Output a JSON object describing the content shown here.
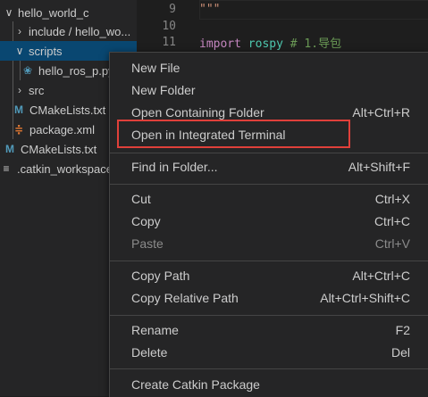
{
  "explorer": {
    "items": [
      {
        "label": "hello_world_c",
        "chevron": "down",
        "icon": ""
      },
      {
        "label": "include / hello_wo...",
        "chevron": "right",
        "icon": ""
      },
      {
        "label": "scripts",
        "chevron": "down",
        "icon": ""
      },
      {
        "label": "hello_ros_p.py",
        "chevron": "",
        "icon": "python-file-icon"
      },
      {
        "label": "src",
        "chevron": "right",
        "icon": ""
      },
      {
        "label": "CMakeLists.txt",
        "chevron": "",
        "icon": "cmake-file-icon"
      },
      {
        "label": "package.xml",
        "chevron": "",
        "icon": "rss-xml-file-icon"
      },
      {
        "label": "CMakeLists.txt",
        "chevron": "",
        "icon": "cmake-file-icon"
      },
      {
        "label": ".catkin_workspace",
        "chevron": "",
        "icon": "config-file-icon"
      }
    ]
  },
  "editor": {
    "lines": [
      {
        "num": "9",
        "text": "\"\"\""
      },
      {
        "num": "10",
        "text": ""
      },
      {
        "num": "11",
        "kw": "import",
        "mod": "rospy",
        "comment": "# 1.导包"
      }
    ]
  },
  "context_menu": {
    "items": [
      {
        "label": "New File",
        "key": ""
      },
      {
        "label": "New Folder",
        "key": ""
      },
      {
        "label": "Open Containing Folder",
        "key": "Alt+Ctrl+R"
      },
      {
        "label": "Open in Integrated Terminal",
        "key": ""
      },
      {
        "label": "Find in Folder...",
        "key": "Alt+Shift+F"
      },
      {
        "label": "Cut",
        "key": "Ctrl+X"
      },
      {
        "label": "Copy",
        "key": "Ctrl+C"
      },
      {
        "label": "Paste",
        "key": "Ctrl+V"
      },
      {
        "label": "Copy Path",
        "key": "Alt+Ctrl+C"
      },
      {
        "label": "Copy Relative Path",
        "key": "Alt+Ctrl+Shift+C"
      },
      {
        "label": "Rename",
        "key": "F2"
      },
      {
        "label": "Delete",
        "key": "Del"
      },
      {
        "label": "Create Catkin Package",
        "key": ""
      }
    ]
  },
  "colors": {
    "highlight_box": "#e0403a",
    "selection": "#094771",
    "menu_bg": "#252526"
  }
}
